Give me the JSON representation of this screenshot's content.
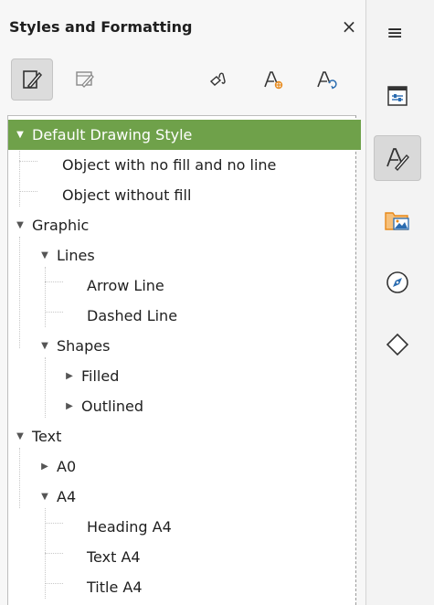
{
  "panel": {
    "title": "Styles and Formatting",
    "close_label": "×"
  },
  "toolbar": {
    "buttons": [
      {
        "name": "drawing-styles",
        "icon": "drawing-styles-icon",
        "active": true
      },
      {
        "name": "presentation-styles",
        "icon": "presentation-styles-icon",
        "active": false
      },
      {
        "name": "fill-format-mode",
        "icon": "fill-format-icon",
        "active": false
      },
      {
        "name": "new-style-from-selection",
        "icon": "new-style-icon",
        "active": false
      },
      {
        "name": "update-style",
        "icon": "update-style-icon",
        "active": false
      }
    ]
  },
  "tree": {
    "items": [
      {
        "label": "Default Drawing Style",
        "level": 0,
        "expander": "expanded",
        "selected": true
      },
      {
        "label": "Object with no fill and no line",
        "level": 1,
        "expander": "none",
        "selected": false
      },
      {
        "label": "Object without fill",
        "level": 1,
        "expander": "none",
        "selected": false
      },
      {
        "label": "Graphic",
        "level": 0,
        "expander": "expanded",
        "selected": false
      },
      {
        "label": "Lines",
        "level": 1,
        "expander": "expanded",
        "selected": false
      },
      {
        "label": "Arrow Line",
        "level": 2,
        "expander": "none",
        "selected": false
      },
      {
        "label": "Dashed Line",
        "level": 2,
        "expander": "none",
        "selected": false
      },
      {
        "label": "Shapes",
        "level": 1,
        "expander": "expanded",
        "selected": false
      },
      {
        "label": "Filled",
        "level": 2,
        "expander": "collapsed",
        "selected": false
      },
      {
        "label": "Outlined",
        "level": 2,
        "expander": "collapsed",
        "selected": false
      },
      {
        "label": "Text",
        "level": 0,
        "expander": "expanded",
        "selected": false
      },
      {
        "label": "A0",
        "level": 1,
        "expander": "collapsed",
        "selected": false
      },
      {
        "label": "A4",
        "level": 1,
        "expander": "expanded",
        "selected": false
      },
      {
        "label": "Heading A4",
        "level": 2,
        "expander": "none",
        "selected": false
      },
      {
        "label": "Text A4",
        "level": 2,
        "expander": "none",
        "selected": false
      },
      {
        "label": "Title A4",
        "level": 2,
        "expander": "none",
        "selected": false
      }
    ]
  },
  "sidebar": {
    "menu_label": "≡",
    "buttons": [
      {
        "name": "properties",
        "icon": "properties-icon",
        "active": false
      },
      {
        "name": "styles",
        "icon": "styles-icon",
        "active": true
      },
      {
        "name": "gallery",
        "icon": "gallery-icon",
        "active": false
      },
      {
        "name": "navigator",
        "icon": "navigator-icon",
        "active": false
      },
      {
        "name": "shapes",
        "icon": "shapes-icon",
        "active": false
      }
    ]
  },
  "colors": {
    "selection": "#6fa14a",
    "accent_orange": "#e8891a",
    "accent_blue": "#2b6cb0"
  }
}
